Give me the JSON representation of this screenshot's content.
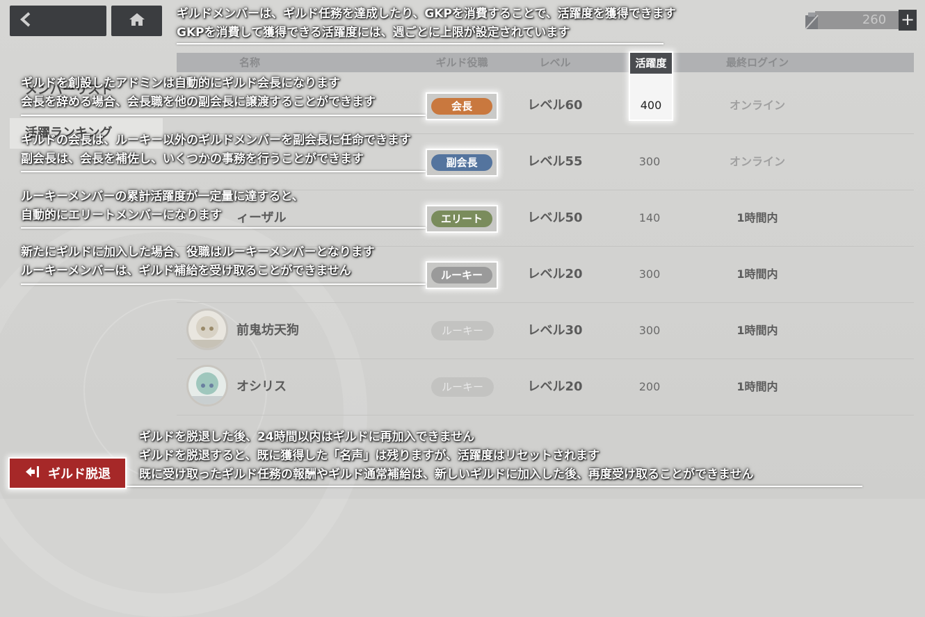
{
  "currency": {
    "amount": "260",
    "plus_label": "+",
    "icon": "gkp-icon"
  },
  "table": {
    "headers": {
      "name": "名称",
      "role": "ギルド役職",
      "level": "レベル",
      "activity": "活躍度",
      "last_login": "最終ログイン"
    },
    "rows": [
      {
        "name": "",
        "role": "会長",
        "level": "レベル60",
        "activity": "400",
        "last_login": "オンライン"
      },
      {
        "name": "",
        "role": "副会長",
        "level": "レベル55",
        "activity": "300",
        "last_login": "オンライン"
      },
      {
        "name": "ィーザル",
        "role": "エリート",
        "level": "レベル50",
        "activity": "140",
        "last_login": "1時間内"
      },
      {
        "name": "",
        "role": "ルーキー",
        "level": "レベル20",
        "activity": "300",
        "last_login": "1時間内"
      },
      {
        "name": "前鬼坊天狗",
        "role": "ルーキー",
        "level": "レベル30",
        "activity": "300",
        "last_login": "1時間内"
      },
      {
        "name": "オシリス",
        "role": "ルーキー",
        "level": "レベル20",
        "activity": "200",
        "last_login": "1時間内"
      }
    ]
  },
  "sidebar": {
    "items": [
      {
        "label": "メンバーリスト"
      },
      {
        "label": "活躍ランキング"
      }
    ]
  },
  "annotations": {
    "top_line1": "ギルドメンバーは、ギルド任務を達成したり、GKPを消費することで、活躍度を獲得できます",
    "top_line2": "GKPを消費して獲得できる活躍度には、週ごとに上限が設定されています",
    "leader_line1": "ギルドを創設したアドミンは自動的にギルド会長になります",
    "leader_line2": "会長を辞める場合、会長職を他の副会長に譲渡することができます",
    "vice_line1": "ギルドの会長は、ルーキー以外のギルドメンバーを副会長に任命できます",
    "vice_line2": "副会長は、会長を補佐し、いくつかの事務を行うことができます",
    "elite_line1": "ルーキーメンバーの累計活躍度が一定量に達すると、",
    "elite_line2": "自動的にエリートメンバーになります",
    "rookie_line1": "新たにギルドに加入した場合、役職はルーキーメンバーとなります",
    "rookie_line2": "ルーキーメンバーは、ギルド補給を受け取ることができません",
    "leave_line1": "ギルドを脱退した後、24時間以内はギルドに再加入できません",
    "leave_line2": "ギルドを脱退すると、既に獲得した「名声」は残りますが、活躍度はリセットされます",
    "leave_line3": "既に受け取ったギルド任務の報酬やギルド通常補給は、新しいギルドに加入した後、再度受け取ることができません"
  },
  "badges": {
    "leader": {
      "label": "会長",
      "color": "#c9783e"
    },
    "vice": {
      "label": "副会長",
      "color": "#54749e"
    },
    "elite": {
      "label": "エリート",
      "color": "#7a8c5c"
    },
    "rookie": {
      "label": "ルーキー",
      "color": "#9a9a9a"
    }
  },
  "leave_button": {
    "label": "ギルド脱退",
    "icon": "exit-icon"
  },
  "nav": {
    "back_icon": "back-arrow-icon",
    "home_icon": "home-icon"
  }
}
